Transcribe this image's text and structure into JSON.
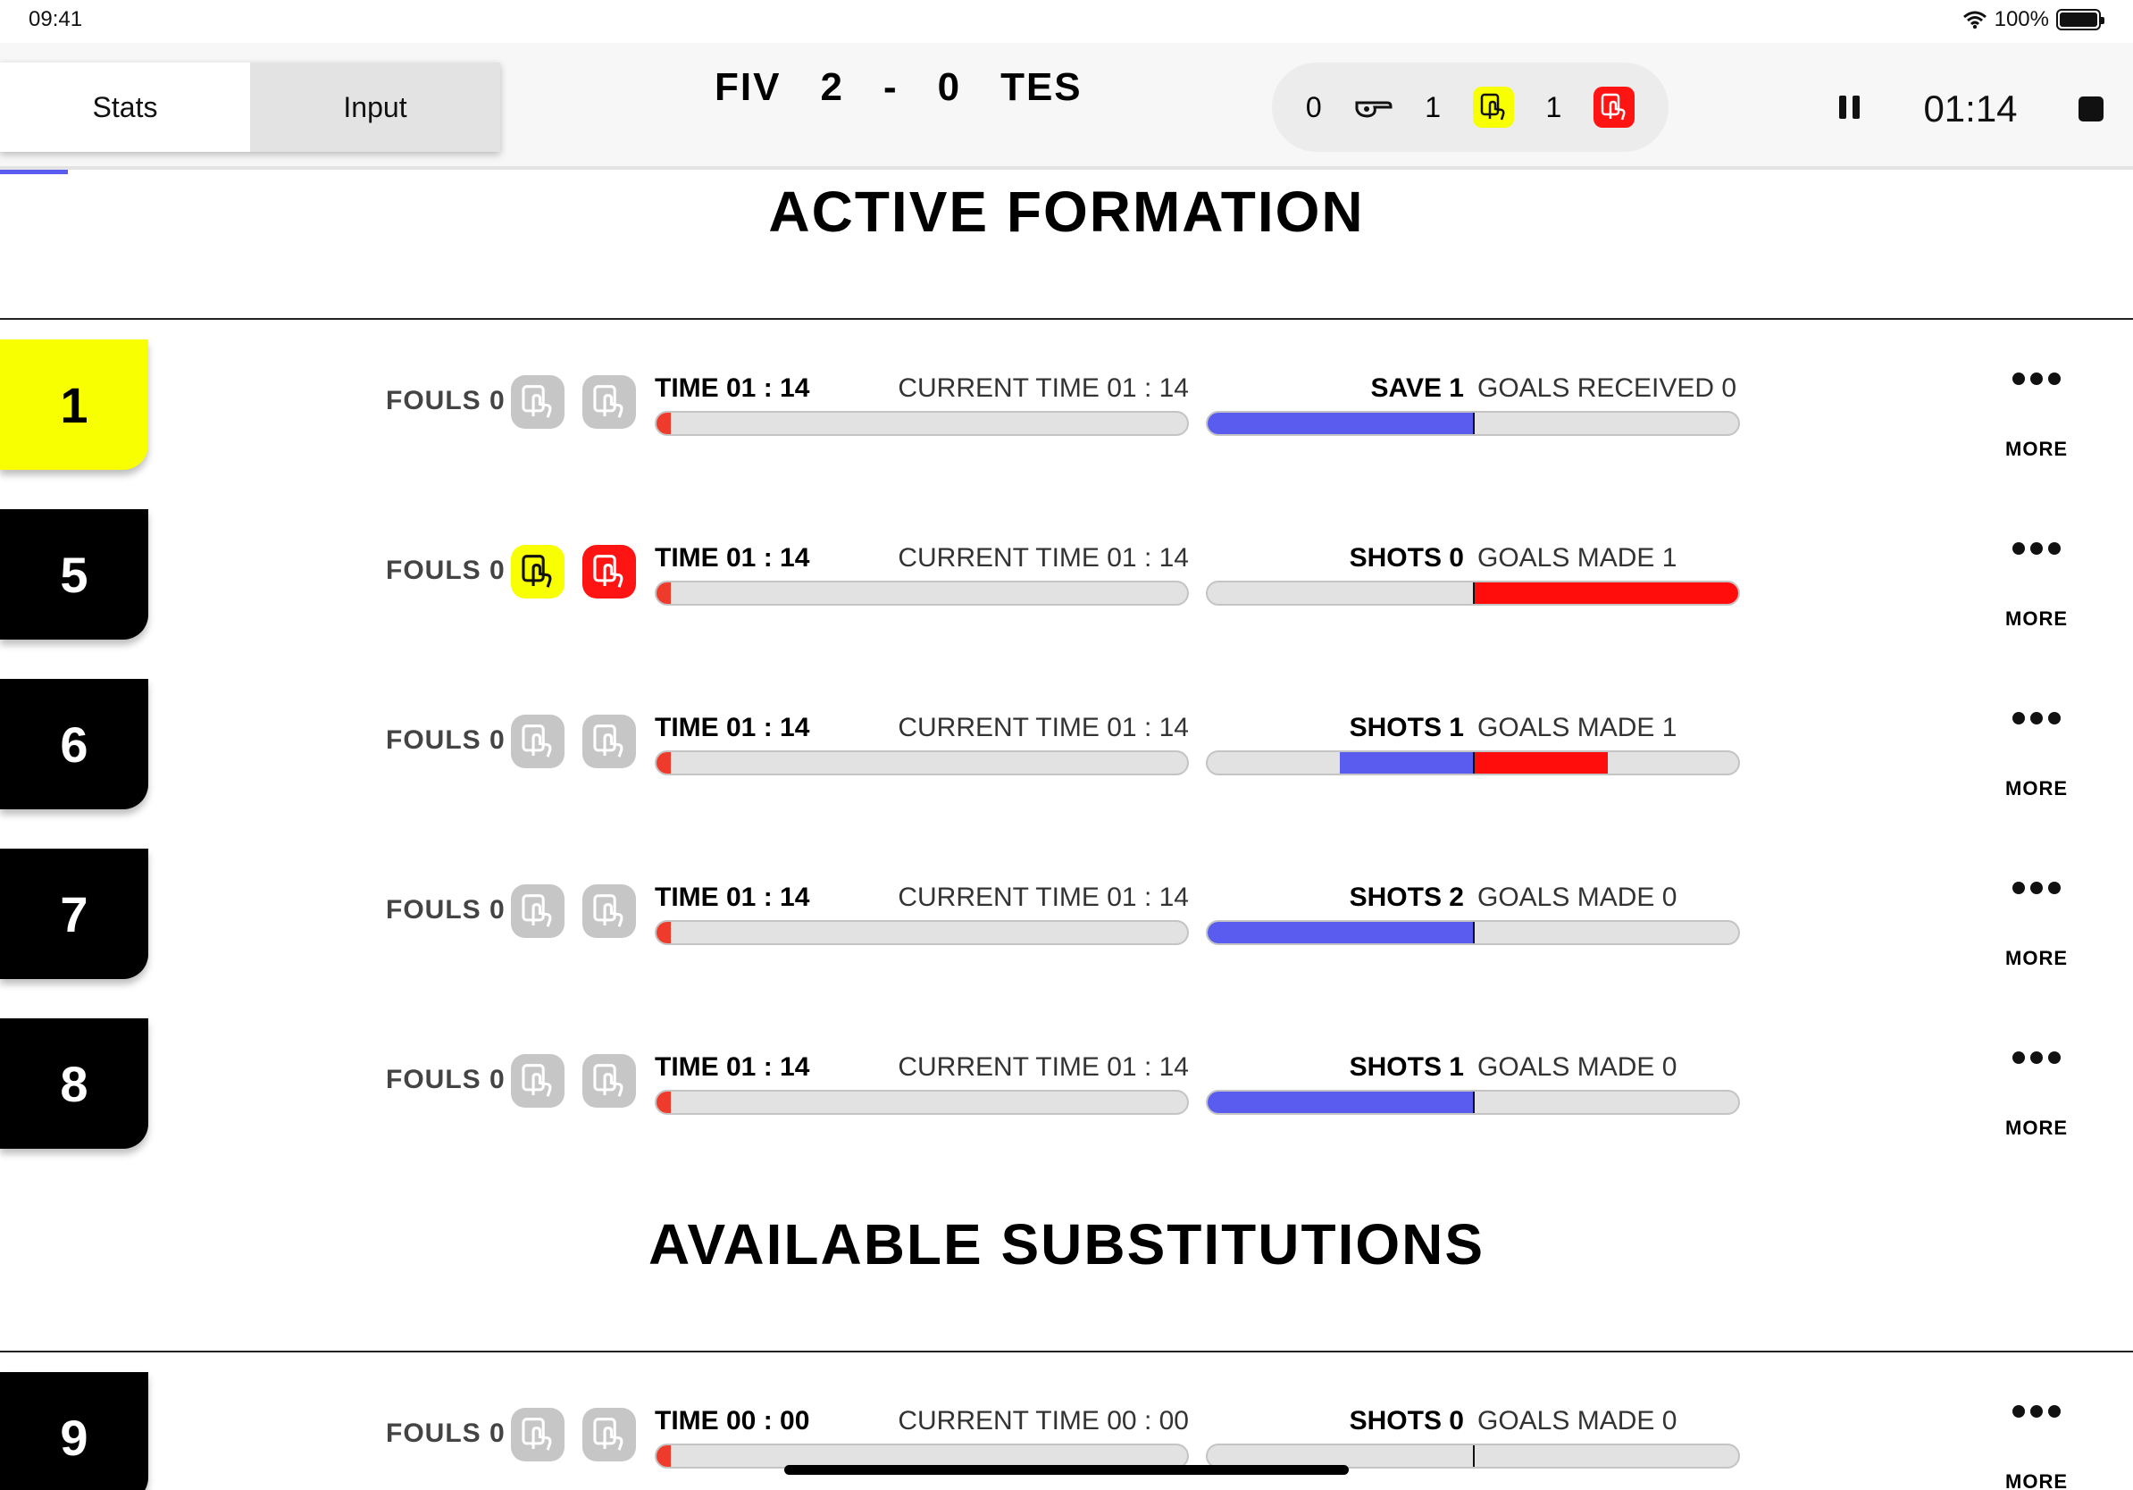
{
  "status_bar": {
    "time": "09:41",
    "battery": "100%"
  },
  "tabs": [
    {
      "label": "Stats",
      "active": true
    },
    {
      "label": "Input",
      "active": false
    }
  ],
  "score": {
    "home_team": "FIV",
    "home_score": "2",
    "separator": "-",
    "away_score": "0",
    "away_team": "TES"
  },
  "foul_summary": {
    "fouls": "0",
    "yellow_cards": "1",
    "red_cards": "1",
    "icons": [
      "whistle-icon",
      "yellow-card-icon",
      "red-card-icon"
    ]
  },
  "clock": {
    "time": "01:14",
    "icons": [
      "pause-icon",
      "stop-icon"
    ]
  },
  "colors": {
    "accent_blue": "#5a5cf0",
    "goalkeeper_yellow": "#f8ff00",
    "red": "#ff0d0d"
  },
  "active_formation": {
    "title": "ACTIVE FORMATION",
    "players": [
      {
        "number": "1",
        "goalkeeper": true,
        "fouls": "FOULS 0",
        "yellow": false,
        "red": false,
        "time": "TIME 01 : 14",
        "current_time": "CURRENT TIME 01 : 14",
        "stat_main": "SAVE 1",
        "stat_secondary": "GOALS RECEIVED 0",
        "blue_left": 0.5,
        "red_right": 0,
        "more": "MORE"
      },
      {
        "number": "5",
        "goalkeeper": false,
        "fouls": "FOULS 0",
        "yellow": true,
        "red": true,
        "time": "TIME 01 : 14",
        "current_time": "CURRENT TIME 01 : 14",
        "stat_main": "SHOTS 0",
        "stat_secondary": "GOALS MADE 1",
        "blue_left": 0,
        "red_right": 0.5,
        "more": "MORE"
      },
      {
        "number": "6",
        "goalkeeper": false,
        "fouls": "FOULS 0",
        "yellow": false,
        "red": false,
        "time": "TIME 01 : 14",
        "current_time": "CURRENT TIME 01 : 14",
        "stat_main": "SHOTS 1",
        "stat_secondary": "GOALS MADE 1",
        "blue_left": 0.25,
        "red_right": 0.25,
        "more": "MORE"
      },
      {
        "number": "7",
        "goalkeeper": false,
        "fouls": "FOULS 0",
        "yellow": false,
        "red": false,
        "time": "TIME 01 : 14",
        "current_time": "CURRENT TIME 01 : 14",
        "stat_main": "SHOTS 2",
        "stat_secondary": "GOALS MADE 0",
        "blue_left": 0.5,
        "red_right": 0,
        "more": "MORE"
      },
      {
        "number": "8",
        "goalkeeper": false,
        "fouls": "FOULS 0",
        "yellow": false,
        "red": false,
        "time": "TIME 01 : 14",
        "current_time": "CURRENT TIME 01 : 14",
        "stat_main": "SHOTS 1",
        "stat_secondary": "GOALS MADE 0",
        "blue_left": 0.5,
        "red_right": 0,
        "more": "MORE"
      }
    ]
  },
  "substitutions": {
    "title": "AVAILABLE SUBSTITUTIONS",
    "players": [
      {
        "number": "9",
        "goalkeeper": false,
        "fouls": "FOULS 0",
        "yellow": false,
        "red": false,
        "time": "TIME 00 : 00",
        "current_time": "CURRENT TIME 00 : 00",
        "stat_main": "SHOTS 0",
        "stat_secondary": "GOALS MADE 0",
        "blue_left": 0,
        "red_right": 0,
        "more": "MORE"
      }
    ]
  }
}
